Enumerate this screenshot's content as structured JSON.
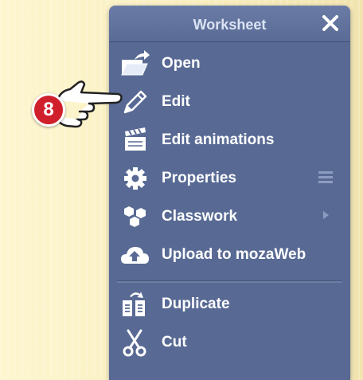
{
  "panel": {
    "title": "Worksheet"
  },
  "menu": {
    "items": [
      {
        "label": "Open",
        "icon": "folder-open-icon"
      },
      {
        "label": "Edit",
        "icon": "pencil-icon"
      },
      {
        "label": "Edit animations",
        "icon": "clapperboard-icon"
      },
      {
        "label": "Properties",
        "icon": "gear-icon",
        "trailing": "hamburger-icon"
      },
      {
        "label": "Classwork",
        "icon": "hexagons-icon",
        "trailing": "chevron-right-icon"
      },
      {
        "label": "Upload to mozaWeb",
        "icon": "cloud-upload-icon"
      },
      {
        "label": "Duplicate",
        "icon": "duplicate-icon"
      },
      {
        "label": "Cut",
        "icon": "scissors-icon"
      }
    ]
  },
  "step_badge": {
    "number": "8"
  },
  "colors": {
    "panel": "#586a94",
    "header_text": "#dbe3f3",
    "badge": "#d0202c"
  }
}
